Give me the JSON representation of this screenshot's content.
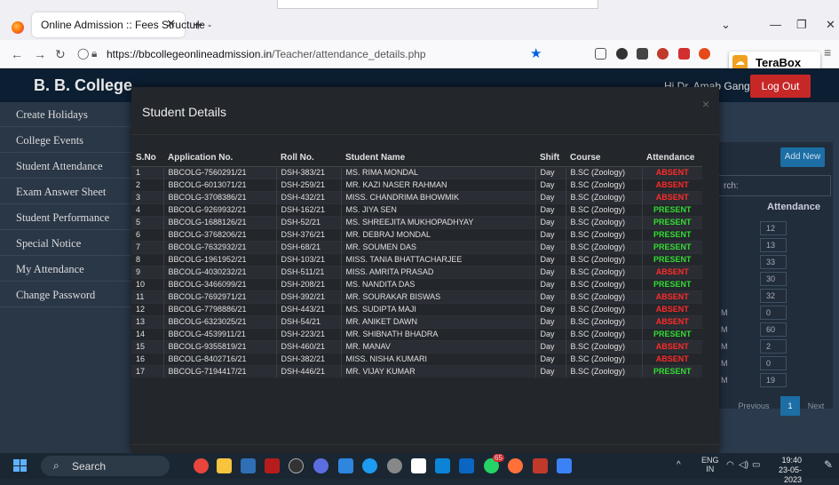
{
  "browser": {
    "tab_title": "Online Admission :: Fees Structure - ",
    "url_domain": "https://bbcollegeonlineadmission.in",
    "url_path": "/Teacher/attendance_details.php",
    "extension_popup": "TeraBox"
  },
  "app": {
    "brand": "B. B. College",
    "greeting": "Hi Dr. Amab Ganguli ,",
    "logout_label": "Log Out"
  },
  "sidebar": {
    "items": [
      {
        "label": "Create Holidays"
      },
      {
        "label": "College Events"
      },
      {
        "label": "Student Attendance"
      },
      {
        "label": "Exam Answer Sheet"
      },
      {
        "label": "Student Performance"
      },
      {
        "label": "Special Notice"
      },
      {
        "label": "My Attendance"
      },
      {
        "label": "Change Password"
      }
    ]
  },
  "background_panel": {
    "add_new_label": "Add New",
    "search_label": "rch:",
    "attendance_header": "Attendance",
    "attendance_values": [
      "12",
      "13",
      "33",
      "30",
      "32",
      "0",
      "60",
      "2",
      "0",
      "19"
    ],
    "row_markers": [
      "M",
      "M",
      "M",
      "M",
      "M"
    ],
    "pagination": {
      "previous": "Previous",
      "current": "1",
      "next": "Next"
    }
  },
  "modal": {
    "title": "Student Details",
    "close": "×",
    "columns": [
      "S.No",
      "Application No.",
      "Roll No.",
      "Student Name",
      "Shift",
      "Course",
      "Attendance"
    ],
    "rows": [
      {
        "sno": "1",
        "app": "BBCOLG-7560291/21",
        "roll": "DSH-383/21",
        "name": "MS. RIMA MONDAL",
        "shift": "Day",
        "course": "B.SC (Zoology)",
        "att": "ABSENT"
      },
      {
        "sno": "2",
        "app": "BBCOLG-6013071/21",
        "roll": "DSH-259/21",
        "name": "MR. KAZI NASER RAHMAN",
        "shift": "Day",
        "course": "B.SC (Zoology)",
        "att": "ABSENT"
      },
      {
        "sno": "3",
        "app": "BBCOLG-3708386/21",
        "roll": "DSH-432/21",
        "name": "MISS. CHANDRIMA BHOWMIK",
        "shift": "Day",
        "course": "B.SC (Zoology)",
        "att": "ABSENT"
      },
      {
        "sno": "4",
        "app": "BBCOLG-9269932/21",
        "roll": "DSH-162/21",
        "name": "MS. JIYA SEN",
        "shift": "Day",
        "course": "B.SC (Zoology)",
        "att": "PRESENT"
      },
      {
        "sno": "5",
        "app": "BBCOLG-1688126/21",
        "roll": "DSH-52/21",
        "name": "MS. SHREEJITA MUKHOPADHYAY",
        "shift": "Day",
        "course": "B.SC (Zoology)",
        "att": "PRESENT"
      },
      {
        "sno": "6",
        "app": "BBCOLG-3768206/21",
        "roll": "DSH-376/21",
        "name": "MR. DEBRAJ MONDAL",
        "shift": "Day",
        "course": "B.SC (Zoology)",
        "att": "PRESENT"
      },
      {
        "sno": "7",
        "app": "BBCOLG-7632932/21",
        "roll": "DSH-68/21",
        "name": "MR. SOUMEN DAS",
        "shift": "Day",
        "course": "B.SC (Zoology)",
        "att": "PRESENT"
      },
      {
        "sno": "8",
        "app": "BBCOLG-1961952/21",
        "roll": "DSH-103/21",
        "name": "MISS. TANIA BHATTACHARJEE",
        "shift": "Day",
        "course": "B.SC (Zoology)",
        "att": "PRESENT"
      },
      {
        "sno": "9",
        "app": "BBCOLG-4030232/21",
        "roll": "DSH-511/21",
        "name": "MISS. AMRITA PRASAD",
        "shift": "Day",
        "course": "B.SC (Zoology)",
        "att": "ABSENT"
      },
      {
        "sno": "10",
        "app": "BBCOLG-3466099/21",
        "roll": "DSH-208/21",
        "name": "MS. NANDITA DAS",
        "shift": "Day",
        "course": "B.SC (Zoology)",
        "att": "PRESENT"
      },
      {
        "sno": "11",
        "app": "BBCOLG-7692971/21",
        "roll": "DSH-392/21",
        "name": "MR. SOURAKAR BISWAS",
        "shift": "Day",
        "course": "B.SC (Zoology)",
        "att": "ABSENT"
      },
      {
        "sno": "12",
        "app": "BBCOLG-7798886/21",
        "roll": "DSH-443/21",
        "name": "MS. SUDIPTA MAJI",
        "shift": "Day",
        "course": "B.SC (Zoology)",
        "att": "ABSENT"
      },
      {
        "sno": "13",
        "app": "BBCOLG-6323025/21",
        "roll": "DSH-54/21",
        "name": "MR. ANIKET DAWN",
        "shift": "Day",
        "course": "B.SC (Zoology)",
        "att": "ABSENT"
      },
      {
        "sno": "14",
        "app": "BBCOLG-4539911/21",
        "roll": "DSH-223/21",
        "name": "MR. SHIBNATH BHADRA",
        "shift": "Day",
        "course": "B.SC (Zoology)",
        "att": "PRESENT"
      },
      {
        "sno": "15",
        "app": "BBCOLG-9355819/21",
        "roll": "DSH-460/21",
        "name": "MR. MANAV",
        "shift": "Day",
        "course": "B.SC (Zoology)",
        "att": "ABSENT"
      },
      {
        "sno": "16",
        "app": "BBCOLG-8402716/21",
        "roll": "DSH-382/21",
        "name": "MISS. NISHA KUMARI",
        "shift": "Day",
        "course": "B.SC (Zoology)",
        "att": "ABSENT"
      },
      {
        "sno": "17",
        "app": "BBCOLG-7194417/21",
        "roll": "DSH-446/21",
        "name": "MR. VIJAY KUMAR",
        "shift": "Day",
        "course": "B.SC (Zoology)",
        "att": "PRESENT"
      }
    ]
  },
  "taskbar": {
    "search_label": "Search",
    "language": "ENG",
    "region": "IN",
    "time": "19:40",
    "date": "23-05-2023",
    "notification_badge": "65"
  },
  "colors": {
    "absent": "#ff2a2a",
    "present": "#33dd33",
    "logout": "#c62828",
    "header_bg": "#0c1e31"
  }
}
